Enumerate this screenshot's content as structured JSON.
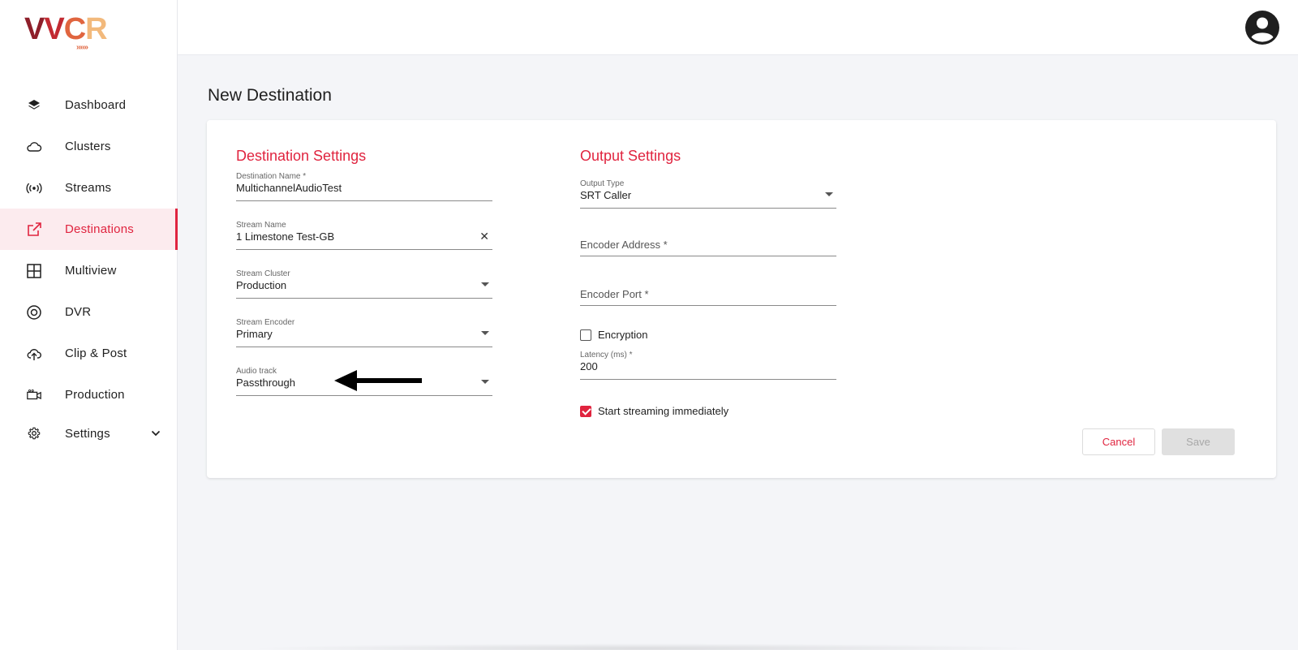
{
  "app": {
    "logo_text": "VVCR",
    "logo_letters": [
      "V",
      "V",
      "C",
      "R"
    ],
    "brand_colors": [
      "#8e1f2a",
      "#c22a32",
      "#e0653f",
      "#f2b97c"
    ],
    "accent_color": "#e0243f"
  },
  "sidebar": {
    "items": [
      {
        "label": "Dashboard",
        "icon": "layers-icon"
      },
      {
        "label": "Clusters",
        "icon": "cloud-icon"
      },
      {
        "label": "Streams",
        "icon": "broadcast-icon"
      },
      {
        "label": "Destinations",
        "icon": "external-link-icon",
        "active": true
      },
      {
        "label": "Multiview",
        "icon": "grid-icon"
      },
      {
        "label": "DVR",
        "icon": "disc-icon"
      },
      {
        "label": "Clip & Post",
        "icon": "cloud-upload-icon"
      },
      {
        "label": "Production",
        "icon": "camera-icon"
      },
      {
        "label": "Settings",
        "icon": "gear-icon",
        "expandable": true
      }
    ]
  },
  "topbar": {
    "avatar_icon": "account-circle-icon"
  },
  "page": {
    "title": "New Destination"
  },
  "destination_settings": {
    "title": "Destination Settings",
    "destination_name": {
      "label": "Destination Name *",
      "value": "MultichannelAudioTest"
    },
    "stream_name": {
      "label": "Stream Name",
      "value": "1 Limestone Test-GB",
      "clear_icon": "close-icon"
    },
    "stream_cluster": {
      "label": "Stream Cluster",
      "value": "Production"
    },
    "stream_encoder": {
      "label": "Stream Encoder",
      "value": "Primary"
    },
    "audio_track": {
      "label": "Audio track",
      "value": "Passthrough"
    }
  },
  "output_settings": {
    "title": "Output Settings",
    "output_type": {
      "label": "Output Type",
      "value": "SRT Caller"
    },
    "encoder_address": {
      "placeholder": "Encoder Address *"
    },
    "encoder_port": {
      "placeholder": "Encoder Port *"
    },
    "encryption": {
      "label": "Encryption",
      "checked": false
    },
    "latency": {
      "label": "Latency (ms) *",
      "value": "200"
    },
    "start_streaming": {
      "label": "Start streaming immediately",
      "checked": true
    }
  },
  "actions": {
    "cancel_label": "Cancel",
    "save_label": "Save",
    "save_enabled": false
  },
  "annotation": {
    "arrow_icon": "left-arrow-icon"
  }
}
